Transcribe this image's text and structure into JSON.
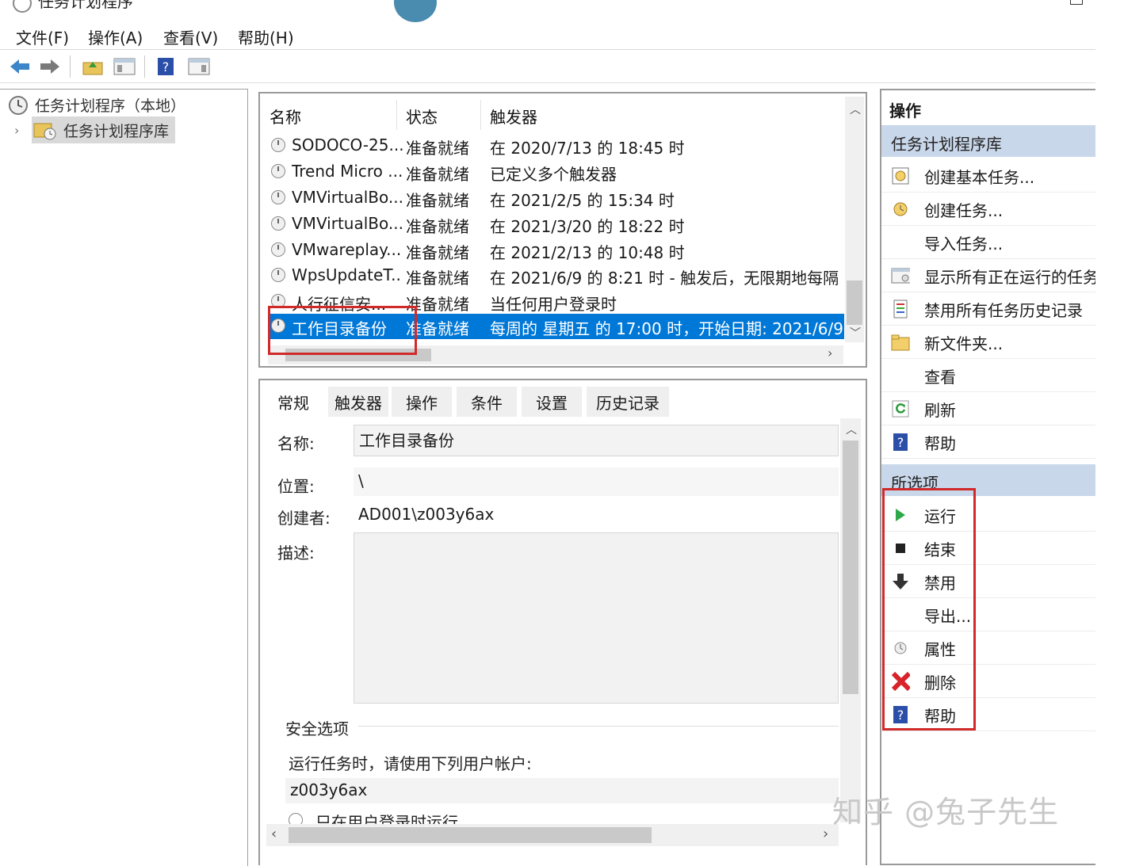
{
  "window": {
    "title": "任务计划程序"
  },
  "menu": [
    "文件(F)",
    "操作(A)",
    "查看(V)",
    "帮助(H)"
  ],
  "tree": {
    "root": "任务计划程序（本地）",
    "child": "任务计划程序库"
  },
  "tasklist": {
    "columns": [
      "名称",
      "状态",
      "触发器"
    ],
    "rows": [
      {
        "name": "SODOCO-25...",
        "status": "准备就绪",
        "trigger": "在 2020/7/13 的 18:45 时"
      },
      {
        "name": "Trend Micro ...",
        "status": "准备就绪",
        "trigger": "已定义多个触发器"
      },
      {
        "name": "VMVirtualBo...",
        "status": "准备就绪",
        "trigger": "在 2021/2/5 的 15:34 时"
      },
      {
        "name": "VMVirtualBo...",
        "status": "准备就绪",
        "trigger": "在 2021/3/20 的 18:22 时"
      },
      {
        "name": "VMwareplay...",
        "status": "准备就绪",
        "trigger": "在 2021/2/13 的 10:48 时"
      },
      {
        "name": "WpsUpdateT...",
        "status": "准备就绪",
        "trigger": "在 2021/6/9 的 8:21 时 - 触发后，无限期地每隔"
      },
      {
        "name": "人行征信安...",
        "status": "准备就绪",
        "trigger": "当任何用户登录时"
      },
      {
        "name": "工作目录备份",
        "status": "准备就绪",
        "trigger": "每周的 星期五 的 17:00 时，开始日期: 2021/6/9"
      }
    ]
  },
  "details": {
    "tabs": [
      "常规",
      "触发器",
      "操作",
      "条件",
      "设置",
      "历史记录"
    ],
    "name_label": "名称:",
    "name_value": "工作目录备份",
    "location_label": "位置:",
    "location_value": "\\",
    "author_label": "创建者:",
    "author_value": "AD001\\z003y6ax",
    "desc_label": "描述:",
    "security_title": "安全选项",
    "security_text": "运行任务时，请使用下列用户帐户:",
    "security_user": "z003y6ax",
    "security_option": "只在用户登录时运行"
  },
  "actions": {
    "title": "操作",
    "section1": "任务计划程序库",
    "items1": [
      {
        "label": "创建基本任务...",
        "icon": "create-basic-task-icon"
      },
      {
        "label": "创建任务...",
        "icon": "create-task-icon"
      },
      {
        "label": "导入任务...",
        "icon": ""
      },
      {
        "label": "显示所有正在运行的任务",
        "icon": "running-tasks-icon"
      },
      {
        "label": "禁用所有任务历史记录",
        "icon": "history-icon"
      },
      {
        "label": "新文件夹...",
        "icon": "folder-icon"
      },
      {
        "label": "查看",
        "icon": ""
      },
      {
        "label": "刷新",
        "icon": "refresh-icon"
      },
      {
        "label": "帮助",
        "icon": "help-icon"
      }
    ],
    "section2": "所选项",
    "items2": [
      {
        "label": "运行",
        "icon": "run-icon"
      },
      {
        "label": "结束",
        "icon": "stop-icon"
      },
      {
        "label": "禁用",
        "icon": "disable-icon"
      },
      {
        "label": "导出...",
        "icon": ""
      },
      {
        "label": "属性",
        "icon": "properties-icon"
      },
      {
        "label": "删除",
        "icon": "delete-icon"
      },
      {
        "label": "帮助",
        "icon": "help-icon"
      }
    ]
  },
  "watermark": "知乎 @兔子先生",
  "colors": {
    "selection": "#0078d7",
    "highlight_box": "#d02a2a",
    "section_header": "#c9d7ea"
  }
}
